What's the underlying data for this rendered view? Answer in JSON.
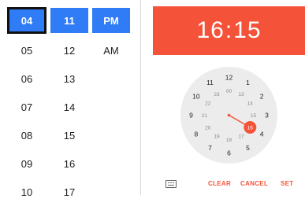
{
  "list_picker": {
    "hours": [
      "04",
      "05",
      "06",
      "07",
      "08",
      "09",
      "10"
    ],
    "minutes": [
      "11",
      "12",
      "13",
      "14",
      "15",
      "16",
      "17"
    ],
    "period": [
      "PM",
      "AM"
    ]
  },
  "clock_dialog": {
    "header": {
      "hour": "16",
      "sep": ":",
      "minute": "15"
    },
    "accent": "#f4533a",
    "outer_numbers": [
      "12",
      "1",
      "2",
      "3",
      "4",
      "5",
      "6",
      "7",
      "8",
      "9",
      "10",
      "11"
    ],
    "inner_numbers": [
      "00",
      "13",
      "14",
      "15",
      "16",
      "17",
      "18",
      "19",
      "20",
      "21",
      "22",
      "23"
    ],
    "selected_value": "16",
    "footer": {
      "keyboard_icon": "keyboard-icon",
      "clear": "CLEAR",
      "cancel": "CANCEL",
      "set": "SET"
    }
  }
}
